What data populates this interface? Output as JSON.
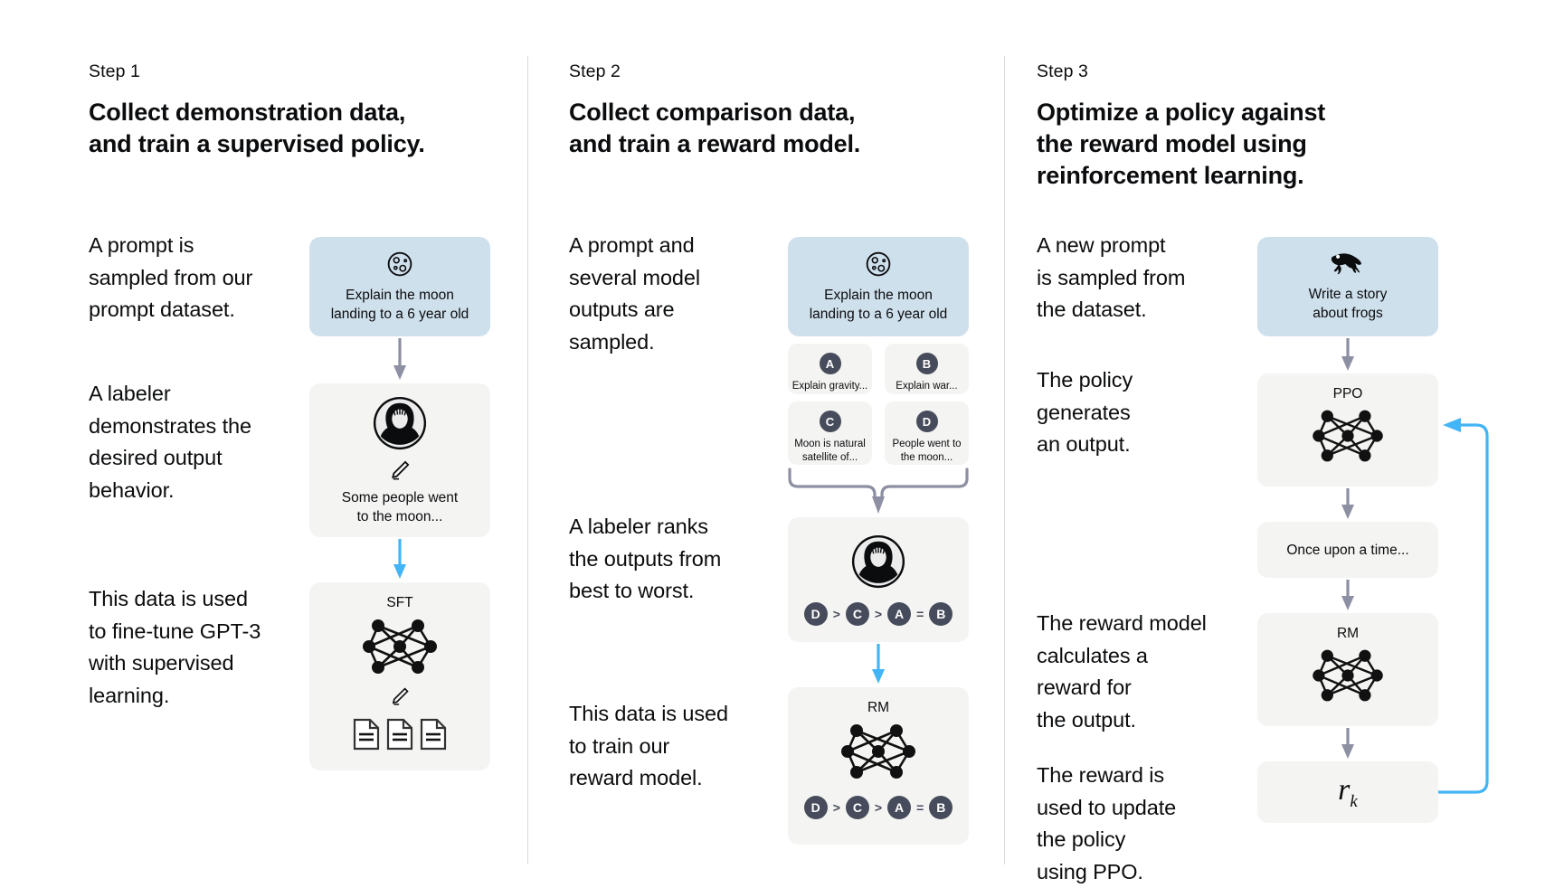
{
  "steps": [
    {
      "label": "Step 1",
      "title": "Collect demonstration data,\nand train a supervised policy.",
      "narratives": [
        "A prompt is\nsampled from our\nprompt dataset.",
        "A labeler\ndemonstrates the\ndesired output\nbehavior.",
        "This data is used\nto fine-tune GPT-3\nwith supervised\nlearning."
      ],
      "cards": {
        "prompt": {
          "icon": "moon-icon",
          "text": "Explain the moon\nlanding to a 6 year old"
        },
        "demo": {
          "icon": "labeler-avatar-icon",
          "sub_icon": "pencil-icon",
          "text": "Some people went\nto the moon..."
        },
        "sft": {
          "model": "SFT",
          "icon": "neural-network-icon",
          "sub_icon": "pencil-icon",
          "docs_icon": "documents-icon"
        }
      }
    },
    {
      "label": "Step 2",
      "title": "Collect comparison data,\nand train a reward model.",
      "narratives": [
        "A prompt and\nseveral model\noutputs are\nsampled.",
        "A labeler ranks\nthe outputs from\nbest to worst.",
        "This data is used\nto train our\nreward model."
      ],
      "cards": {
        "prompt": {
          "icon": "moon-icon",
          "text": "Explain the moon\nlanding to a 6 year old"
        },
        "outputs": [
          {
            "badge": "A",
            "text": "Explain gravity..."
          },
          {
            "badge": "B",
            "text": "Explain war..."
          },
          {
            "badge": "C",
            "text": "Moon is natural\nsatellite of..."
          },
          {
            "badge": "D",
            "text": "People went to\nthe moon..."
          }
        ],
        "ranking": {
          "icon": "labeler-avatar-icon",
          "items": [
            "D",
            ">",
            "C",
            ">",
            "A",
            "=",
            "B"
          ]
        },
        "rm": {
          "model": "RM",
          "icon": "neural-network-icon",
          "items": [
            "D",
            ">",
            "C",
            ">",
            "A",
            "=",
            "B"
          ]
        }
      }
    },
    {
      "label": "Step 3",
      "title": "Optimize a policy against\nthe reward model using\nreinforcement learning.",
      "narratives": [
        "A new prompt\nis sampled from\nthe dataset.",
        "The policy\ngenerates\nan output.",
        "The reward model\ncalculates a\nreward for\nthe output.",
        "The reward is\nused to update\nthe policy\nusing PPO."
      ],
      "cards": {
        "prompt": {
          "icon": "frog-icon",
          "text": "Write a story\nabout frogs"
        },
        "ppo": {
          "model": "PPO",
          "icon": "neural-network-icon"
        },
        "output": {
          "text": "Once upon a time..."
        },
        "rm": {
          "model": "RM",
          "icon": "neural-network-icon"
        },
        "reward": {
          "symbol": "r",
          "subscript": "k"
        }
      }
    }
  ],
  "colors": {
    "prompt_card": "#cfe0ed",
    "grey_card": "#f4f4f2",
    "badge": "#474c5c",
    "grey_arrow": "#8d8fa3",
    "blue_arrow": "#43b4f5",
    "divider": "#d9dadd",
    "text": "#0b0c0e"
  }
}
